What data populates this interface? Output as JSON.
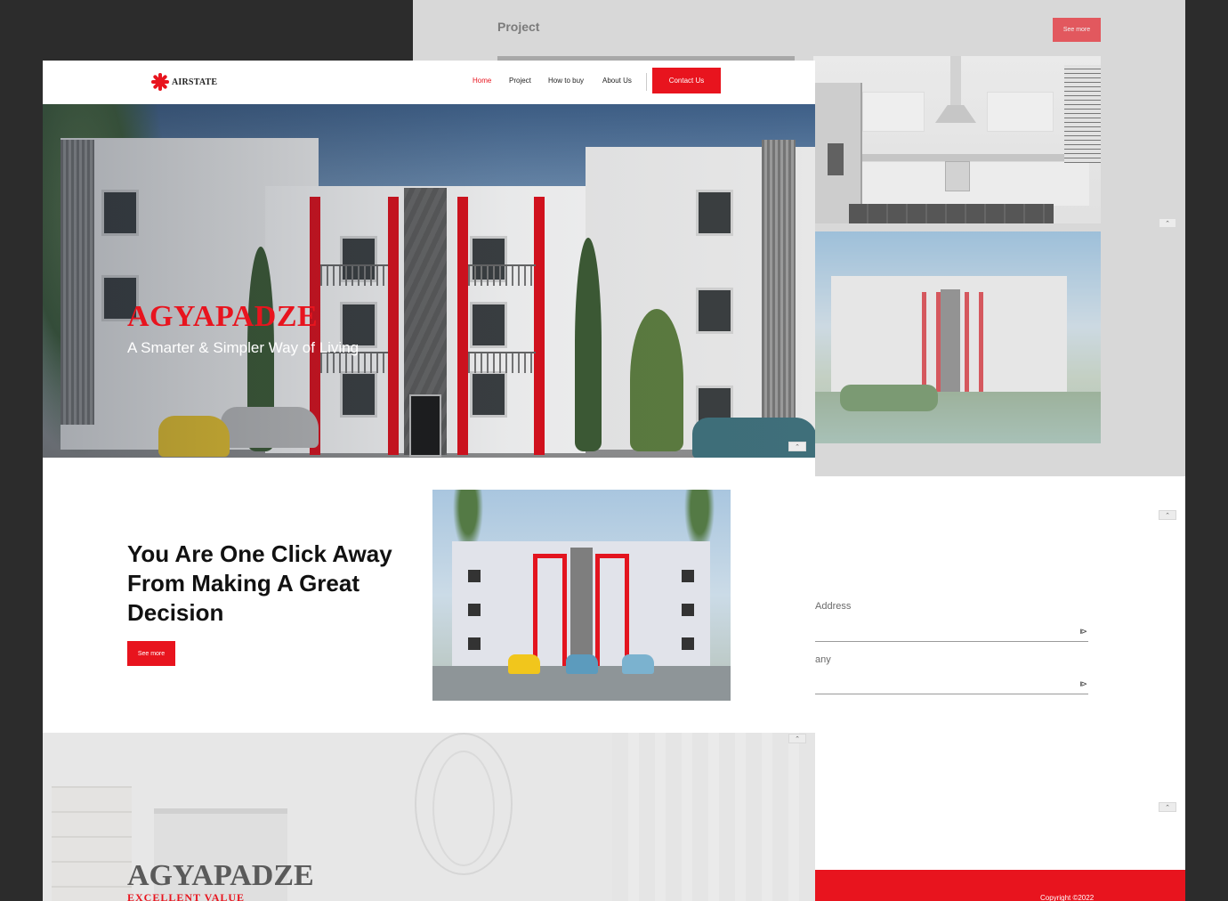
{
  "back": {
    "section_title": "Project",
    "see_more_label": "See more",
    "form": {
      "field1_label": "Address",
      "field2_label": "any",
      "field_icon": "input-assist-icon"
    },
    "scroll_top_glyph": "⌃",
    "copyright": "Copyright ©2022"
  },
  "nav": {
    "logo_text": "AIRSTATE",
    "items": [
      "Home",
      "Project",
      "How to buy",
      "About Us"
    ],
    "active_item": "Home",
    "contact_label": "Contact Us"
  },
  "hero": {
    "title": "AGYAPADZE",
    "subtitle": "A Smarter & Simpler Way of Living"
  },
  "cta": {
    "title": "You Are One Click Away From Making A Great Decision",
    "button_label": "See more"
  },
  "interior": {
    "title": "AGYAPADZE",
    "subtitle": "EXCELLENT VALUE"
  },
  "colors": {
    "accent": "#e8141e",
    "background": "#2c2c2c",
    "project_bg": "#d9d9d9"
  }
}
